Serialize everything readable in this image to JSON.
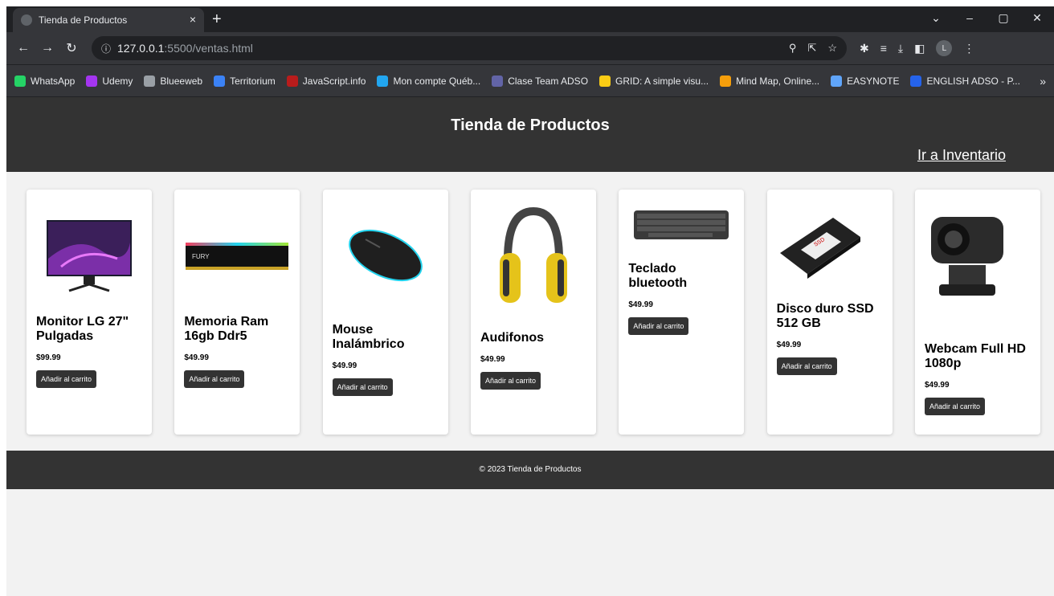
{
  "browser": {
    "tab_title": "Tienda de Productos",
    "tab_close": "×",
    "new_tab": "+",
    "url_host": "127.0.0.1",
    "url_path": ":5500/ventas.html",
    "bookmarks": [
      {
        "label": "WhatsApp",
        "color": "#25d366"
      },
      {
        "label": "Udemy",
        "color": "#a435f0"
      },
      {
        "label": "Blueeweb",
        "color": "#9aa0a6"
      },
      {
        "label": "Territorium",
        "color": "#3b82f6"
      },
      {
        "label": "JavaScript.info",
        "color": "#b91c1c"
      },
      {
        "label": "Mon compte Québ...",
        "color": "#22a6f0"
      },
      {
        "label": "Clase Team ADSO",
        "color": "#6264a7"
      },
      {
        "label": "GRID: A simple visu...",
        "color": "#facc15"
      },
      {
        "label": "Mind Map, Online...",
        "color": "#f59e0b"
      },
      {
        "label": "EASYNOTE",
        "color": "#60a5fa"
      },
      {
        "label": "ENGLISH ADSO - P...",
        "color": "#2563eb"
      }
    ],
    "avatar_initial": "L",
    "more_bookmarks": "»"
  },
  "header": {
    "title": "Tienda de Productos",
    "inventory_link": "Ir a Inventario"
  },
  "products": [
    {
      "name": "Monitor LG 27\" Pulgadas",
      "price": "$99.99",
      "button": "Añadir al carrito",
      "image": "monitor"
    },
    {
      "name": "Memoria Ram 16gb Ddr5",
      "price": "$49.99",
      "button": "Añadir al carrito",
      "image": "ram"
    },
    {
      "name": "Mouse Inalámbrico",
      "price": "$49.99",
      "button": "Añadir al carrito",
      "image": "mouse"
    },
    {
      "name": "Audifonos",
      "price": "$49.99",
      "button": "Añadir al carrito",
      "image": "headphones"
    },
    {
      "name": "Teclado bluetooth",
      "price": "$49.99",
      "button": "Añadir al carrito",
      "image": "keyboard"
    },
    {
      "name": "Disco duro SSD 512 GB",
      "price": "$49.99",
      "button": "Añadir al carrito",
      "image": "ssd"
    },
    {
      "name": "Webcam Full HD 1080p",
      "price": "$49.99",
      "button": "Añadir al carrito",
      "image": "webcam"
    }
  ],
  "footer": {
    "text": "© 2023 Tienda de Productos"
  }
}
